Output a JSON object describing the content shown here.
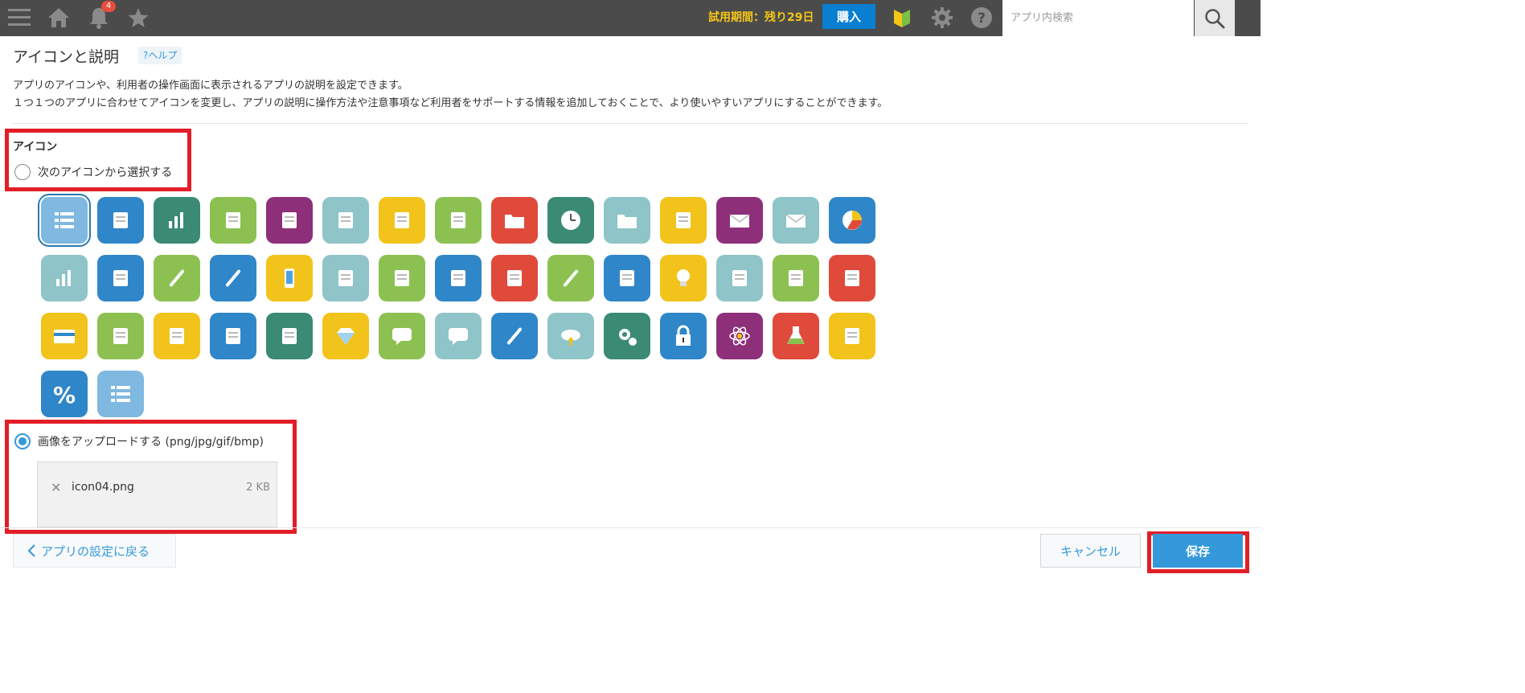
{
  "topbar": {
    "notification_count": "4",
    "trial_text": "試用期間：残り29日",
    "buy_label": "購入",
    "search_placeholder": "アプリ内検索"
  },
  "page": {
    "title": "アイコンと説明",
    "help_label": "?ヘルプ",
    "description_1": "アプリのアイコンや、利用者の操作画面に表示されるアプリの説明を設定できます。",
    "description_2": "１つ１つのアプリに合わせてアイコンを変更し、アプリの説明に操作方法や注意事項など利用者をサポートする情報を追加しておくことで、より使いやすいアプリにすることができます。"
  },
  "icon_section": {
    "label": "アイコン",
    "option_select": "次のアイコンから選択する",
    "option_upload": "画像をアップロードする (png/jpg/gif/bmp)",
    "selected_option": "upload",
    "icons": [
      {
        "name": "list-icon",
        "color": "#7fb8e0"
      },
      {
        "name": "documents-icon",
        "color": "#2f86c9"
      },
      {
        "name": "bar-chart-icon",
        "color": "#3a8a74"
      },
      {
        "name": "laptop-icon",
        "color": "#8cc152"
      },
      {
        "name": "touch-icon",
        "color": "#8e2f7a"
      },
      {
        "name": "calculator-icon",
        "color": "#8fc4c8"
      },
      {
        "name": "clipboard-icon",
        "color": "#f2c31a"
      },
      {
        "name": "printer-icon",
        "color": "#8cc152"
      },
      {
        "name": "binders-icon",
        "color": "#e04a3b"
      },
      {
        "name": "clock-icon",
        "color": "#3a8a74"
      },
      {
        "name": "folder-icon",
        "color": "#8fc4c8"
      },
      {
        "name": "id-card-icon",
        "color": "#f2c31a"
      },
      {
        "name": "envelope-open-icon",
        "color": "#8e2f7a"
      },
      {
        "name": "mail-icon",
        "color": "#8fc4c8"
      },
      {
        "name": "pie-chart-icon",
        "color": "#2f86c9"
      },
      {
        "name": "monitor-chart-icon",
        "color": "#8fc4c8"
      },
      {
        "name": "coffee-cup-icon",
        "color": "#2f86c9"
      },
      {
        "name": "pushpin-icon",
        "color": "#8cc152"
      },
      {
        "name": "paperclip-icon",
        "color": "#2f86c9"
      },
      {
        "name": "smartphone-icon",
        "color": "#f2c31a"
      },
      {
        "name": "telephone-icon",
        "color": "#8fc4c8"
      },
      {
        "name": "briefcase-icon",
        "color": "#8cc152"
      },
      {
        "name": "calendar-icon",
        "color": "#2f86c9"
      },
      {
        "name": "megaphone-icon",
        "color": "#e04a3b"
      },
      {
        "name": "pencil-icon",
        "color": "#8cc152"
      },
      {
        "name": "mouse-icon",
        "color": "#2f86c9"
      },
      {
        "name": "lightbulb-icon",
        "color": "#f2c31a"
      },
      {
        "name": "office-chair-icon",
        "color": "#8fc4c8"
      },
      {
        "name": "wallet-icon",
        "color": "#8cc152"
      },
      {
        "name": "piggy-bank-icon",
        "color": "#e04a3b"
      },
      {
        "name": "credit-card-icon",
        "color": "#f2c31a"
      },
      {
        "name": "card-in-hand-icon",
        "color": "#8cc152"
      },
      {
        "name": "glasses-icon",
        "color": "#f2c31a"
      },
      {
        "name": "abacus-icon",
        "color": "#2f86c9"
      },
      {
        "name": "safe-icon",
        "color": "#3a8a74"
      },
      {
        "name": "diamond-icon",
        "color": "#f2c31a"
      },
      {
        "name": "speech-bubble-icon",
        "color": "#8cc152"
      },
      {
        "name": "thought-bubble-icon",
        "color": "#8fc4c8"
      },
      {
        "name": "wrench-icon",
        "color": "#2f86c9"
      },
      {
        "name": "cloud-upload-icon",
        "color": "#8fc4c8"
      },
      {
        "name": "gears-icon",
        "color": "#3a8a74"
      },
      {
        "name": "padlock-icon",
        "color": "#2f86c9"
      },
      {
        "name": "atom-icon",
        "color": "#8e2f7a"
      },
      {
        "name": "flask-icon",
        "color": "#e04a3b"
      },
      {
        "name": "fuel-pump-icon",
        "color": "#f2c31a"
      },
      {
        "name": "percent-icon",
        "color": "#2f86c9"
      },
      {
        "name": "list-light-icon",
        "color": "#7fb8e0"
      }
    ],
    "file": {
      "name": "icon04.png",
      "size": "2 KB"
    }
  },
  "footer": {
    "back_label": "アプリの設定に戻る",
    "cancel_label": "キャンセル",
    "save_label": "保存"
  },
  "colors": {
    "highlight_red": "#e21e28",
    "accent_blue": "#3498db",
    "topbar_bg": "#4b4b4b"
  }
}
